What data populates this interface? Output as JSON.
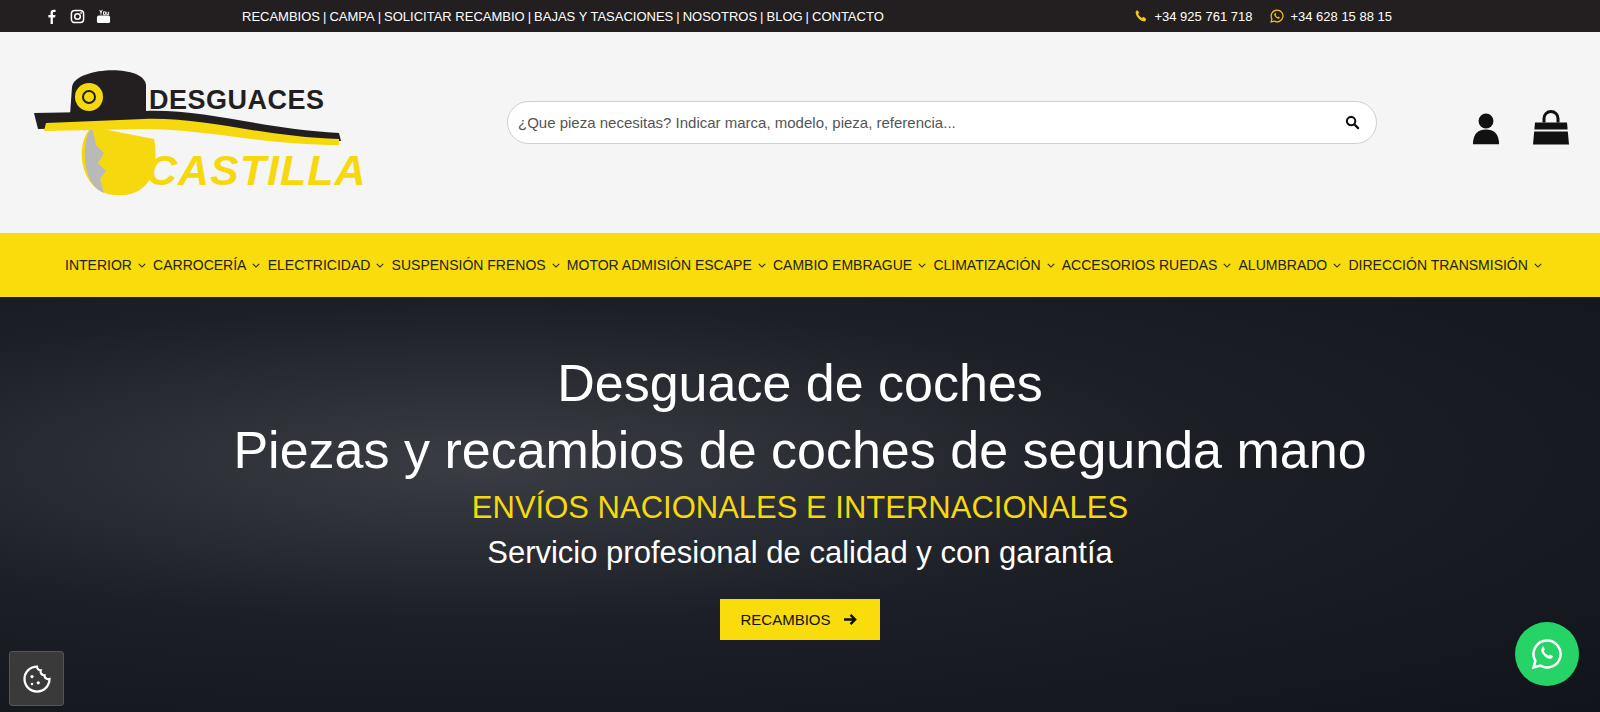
{
  "topbar": {
    "links": [
      "RECAMBIOS",
      "CAMPA",
      "SOLICITAR RECAMBIO",
      "BAJAS Y TASACIONES",
      "NOSOTROS",
      "BLOG",
      "CONTACTO"
    ],
    "separator": "|",
    "phone": "+34 925 761 718",
    "whatsapp": "+34 628 15 88 15"
  },
  "logo": {
    "top": "DESGUACES",
    "bottom": "CASTILLA"
  },
  "search": {
    "placeholder": "¿Que pieza necesitas? Indicar marca, modelo, pieza, referencia..."
  },
  "menu": [
    {
      "label": "INTERIOR"
    },
    {
      "label": "CARROCERÍA"
    },
    {
      "label": "ELECTRICIDAD"
    },
    {
      "label": "SUSPENSIÓN FRENOS"
    },
    {
      "label": "MOTOR ADMISIÓN ESCAPE"
    },
    {
      "label": "CAMBIO EMBRAGUE"
    },
    {
      "label": "CLIMATIZACIÓN"
    },
    {
      "label": "ACCESORIOS RUEDAS"
    },
    {
      "label": "ALUMBRADO"
    },
    {
      "label": "DIRECCIÓN TRANSMISIÓN"
    }
  ],
  "hero": {
    "title": "Desguace de coches",
    "subtitle": "Piezas y recambios de coches de segunda mano",
    "highlight": "ENVÍOS NACIONALES E INTERNACIONALES",
    "tagline": "Servicio profesional de calidad y con garantía",
    "button": "RECAMBIOS"
  }
}
